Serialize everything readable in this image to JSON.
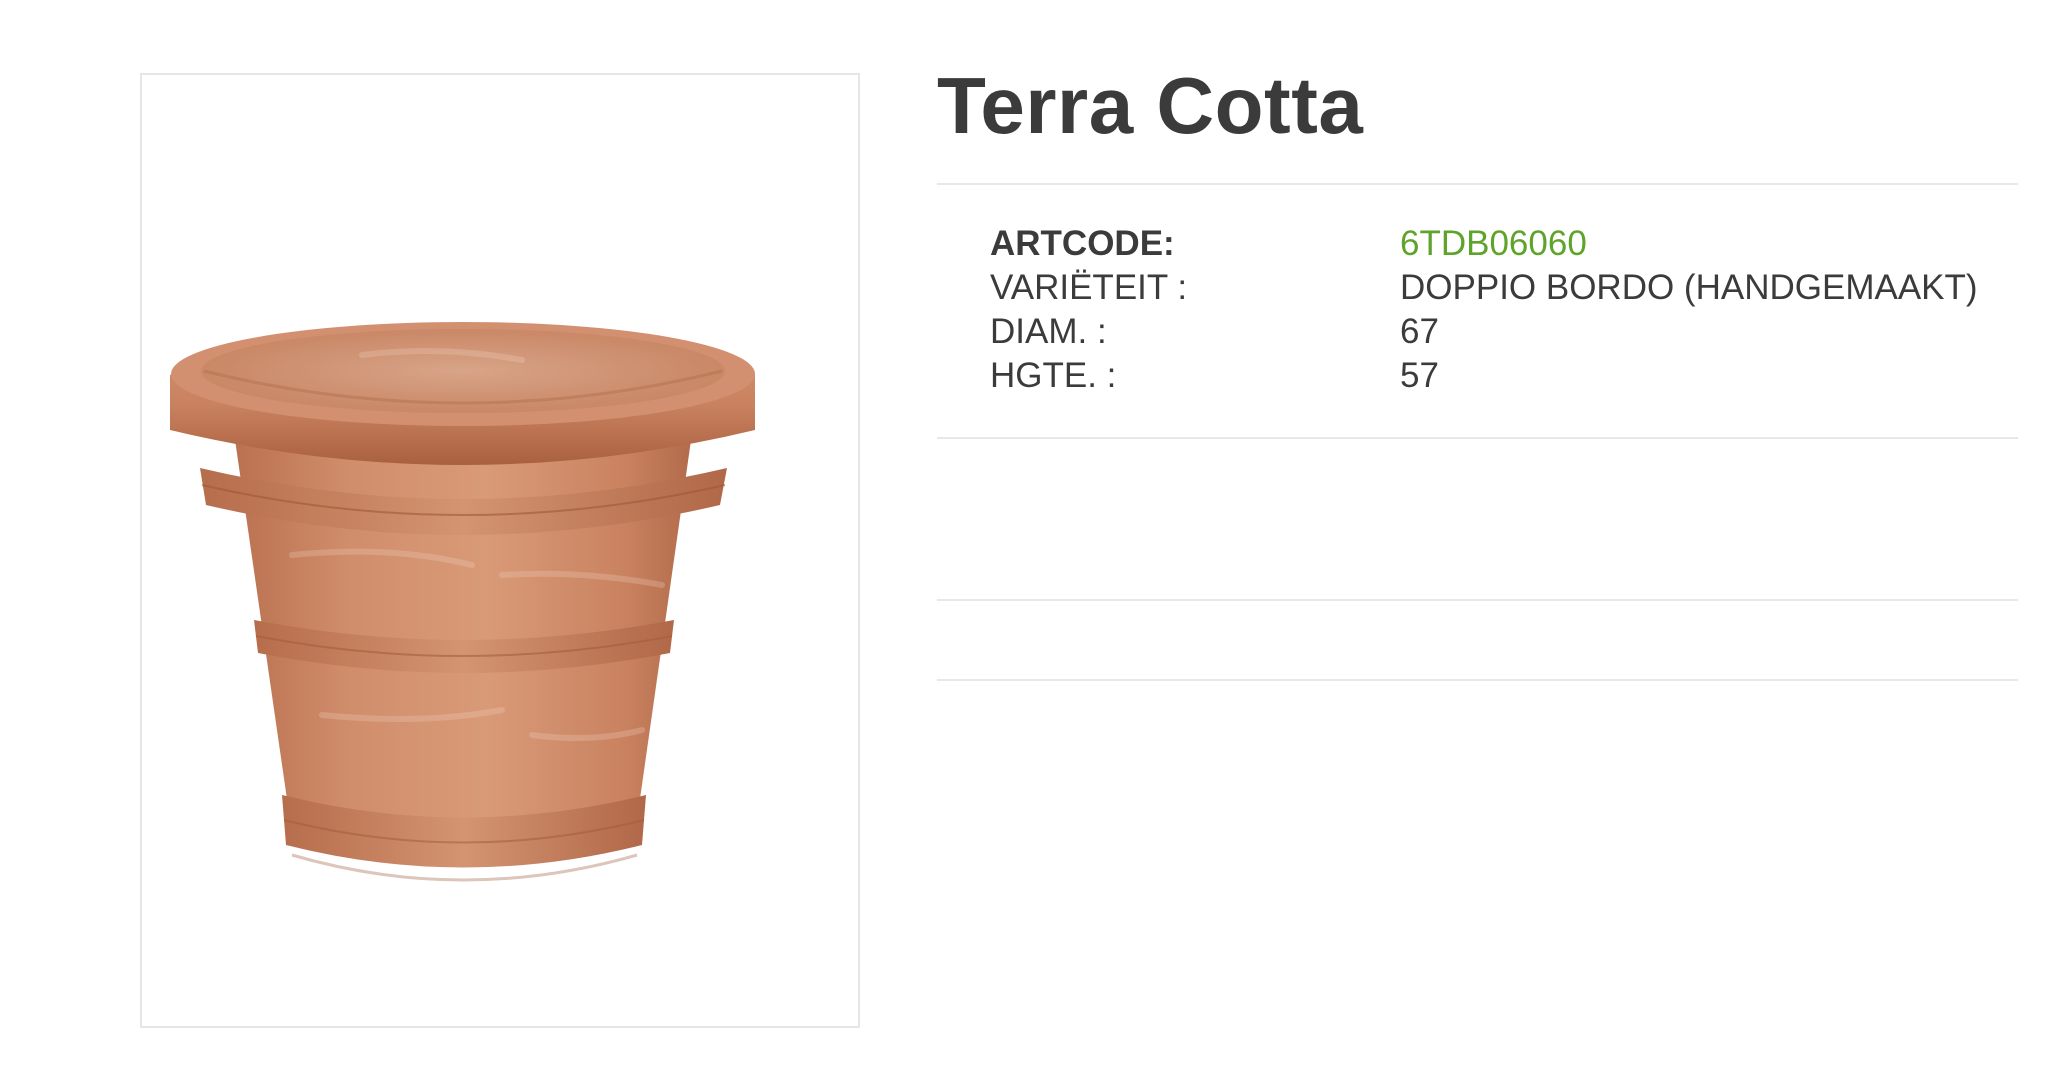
{
  "product": {
    "title": "Terra Cotta",
    "image_alt": "terracotta pot"
  },
  "specs": [
    {
      "label": "ARTCODE:",
      "value": "6TDB06060"
    },
    {
      "label": "VARIËTEIT :",
      "value": "DOPPIO BORDO (HANDGEMAAKT)"
    },
    {
      "label": "DIAM. :",
      "value": "67"
    },
    {
      "label": "HGTE. :",
      "value": "57"
    }
  ],
  "colors": {
    "title": "#3b3b3b",
    "text": "#3b3b3b",
    "accent": "#5ea32a",
    "divider": "#e8e8e8",
    "terracotta": "#c98260"
  }
}
